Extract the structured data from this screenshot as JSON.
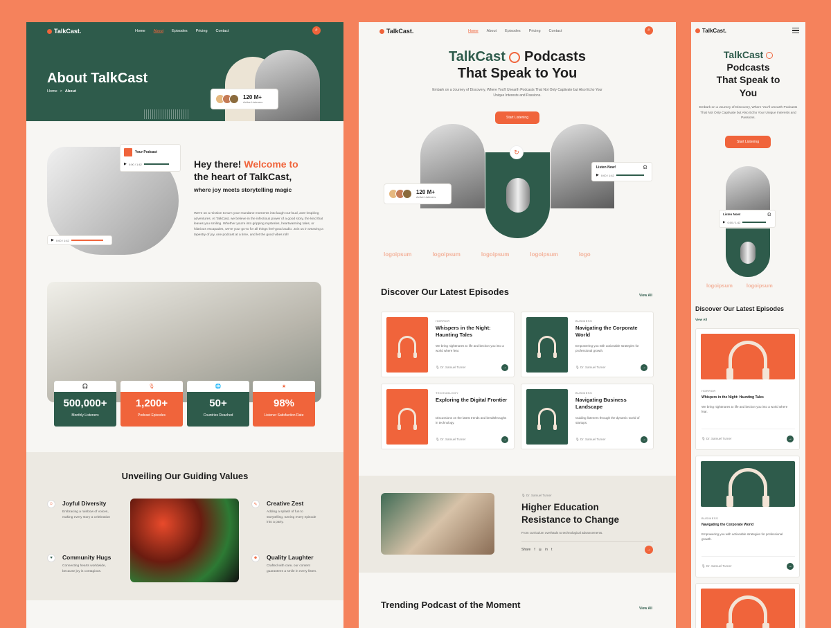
{
  "brand": "TalkCast.",
  "nav": [
    "Home",
    "About",
    "Episodes",
    "Pricing",
    "Contact"
  ],
  "search_icon": "search-icon",
  "colors": {
    "accent": "#f0643b",
    "brand_green": "#2e5b4b",
    "background": "#f5825c"
  },
  "about": {
    "hero_title": "About TalkCast",
    "breadcrumb_home": "Home",
    "breadcrumb_sep": ">",
    "breadcrumb_current": "About",
    "listeners_count": "120 M+",
    "listeners_label": "Active Listeners",
    "player_title": "Your Podcast",
    "player_time": "0:00 / 1:42",
    "welcome_part1": "Hey there! ",
    "welcome_part2": "Welcome to",
    "welcome_part3": "the heart of TalkCast,",
    "welcome_sub": "where joy meets storytelling magic",
    "welcome_body": "We're on a mission to turn your mundane moments into laugh-out-loud, awe-inspiring adventures. At TalkCast, we believe in the infectious power of a good story, the kind that leaves you smiling. Whether you're into gripping mysteries, heartwarming tales, or hilarious escapades, we're your go-to for all things feel-good audio. Join us in weaving a tapestry of joy, one podcast at a time, and let the good vibes roll!",
    "stats": [
      {
        "num": "500,000+",
        "label": "Monthly Listeners",
        "icon": "headphones-icon"
      },
      {
        "num": "1,200+",
        "label": "Podcast Episodes",
        "icon": "microphone-icon"
      },
      {
        "num": "50+",
        "label": "Countries Reached",
        "icon": "globe-icon"
      },
      {
        "num": "98%",
        "label": "Listener Satisfaction Rate",
        "icon": "star-icon"
      }
    ],
    "values_title": "Unveiling Our Guiding Values",
    "values": [
      {
        "title": "Joyful Diversity",
        "text": "Embracing a rainbow of voices, making every story a celebration"
      },
      {
        "title": "Creative Zest",
        "text": "Adding a splash of fun to storytelling, turning every episode into a party."
      },
      {
        "title": "Community Hugs",
        "text": "Connecting hearts worldwide, because joy is contagious."
      },
      {
        "title": "Quality Laughter",
        "text": "Crafted with care, our content guarantees a smile in every listen."
      }
    ]
  },
  "home": {
    "hero_line1a": "TalkCast",
    "hero_line1b": "Podcasts",
    "hero_line2": "That Speak to You",
    "hero_sub": "Embark on a Journey of Discovery, Where You'll Unearth Podcasts That Not Only Captivate but Also Echo Your Unique Interests and Passions.",
    "cta": "Start Listening",
    "listen_now": "Listen Now!",
    "player_time": "0:00 / 1:42",
    "listeners_count": "120 M+",
    "listeners_label": "Active Listeners",
    "logos": [
      "logoipsum",
      "logoipsum",
      "logoipsum",
      "logoipsum",
      "logo"
    ],
    "episodes_title": "Discover Our Latest Episodes",
    "view_all": "View All",
    "episodes": [
      {
        "tag": "HORROR",
        "title": "Whispers in the Night: Haunting Tales",
        "desc": "We bring nightmares to life and beckon you into a world where fear.",
        "author": "Dr. Samuel Turner",
        "color": "#f0643b"
      },
      {
        "tag": "BUSINESS",
        "title": "Navigating the Corporate World",
        "desc": "Empowering you with actionable strategies for professional growth.",
        "author": "Dr. Samuel Turner",
        "color": "#2e5b4b"
      },
      {
        "tag": "TECHNOLOGY",
        "title": "Exploring the Digital Frontier",
        "desc": "Discussions on the latest trends and breakthroughs in technology.",
        "author": "Dr. Samuel Turner",
        "color": "#f0643b"
      },
      {
        "tag": "BUSINESS",
        "title": "Navigating Business Landscape",
        "desc": "Guiding listeners through the dynamic world of startups.",
        "author": "Dr. Samuel Turner",
        "color": "#2e5b4b"
      }
    ],
    "feature_author": "Dr. Samuel Turner",
    "feature_title": "Higher Education Resistance to Change",
    "feature_sub": "From curriculum overhauls to technological advancements.",
    "share_label": "Share",
    "trending_title": "Trending Podcast of the Moment"
  },
  "mobile": {
    "hero_line1": "TalkCast",
    "hero_line2": "Podcasts",
    "hero_line3": "That Speak to",
    "hero_line4": "You",
    "hero_sub": "Embark on a Journey of Discovery, Where You'll Unearth Podcasts That Not Only Captivate but Also Echo Your Unique Interests and Passions.",
    "cta": "Start Listening",
    "listen_now": "Listen Now!",
    "player_time": "0:00 / 1:42",
    "logos": [
      "logoipsum",
      "logoipsum"
    ],
    "episodes_title": "Discover Our Latest Episodes",
    "view_all": "View All",
    "cards": [
      {
        "tag": "HORROR",
        "title": "Whispers in the Night: Haunting Tales",
        "desc": "We bring nightmares to life and beckon you into a world where fear.",
        "author": "Dr. Samuel Turner"
      },
      {
        "tag": "BUSINESS",
        "title": "Navigating the Corporate World",
        "desc": "Empowering you with actionable strategies for professional growth.",
        "author": "Dr. Samuel Turner"
      }
    ]
  }
}
